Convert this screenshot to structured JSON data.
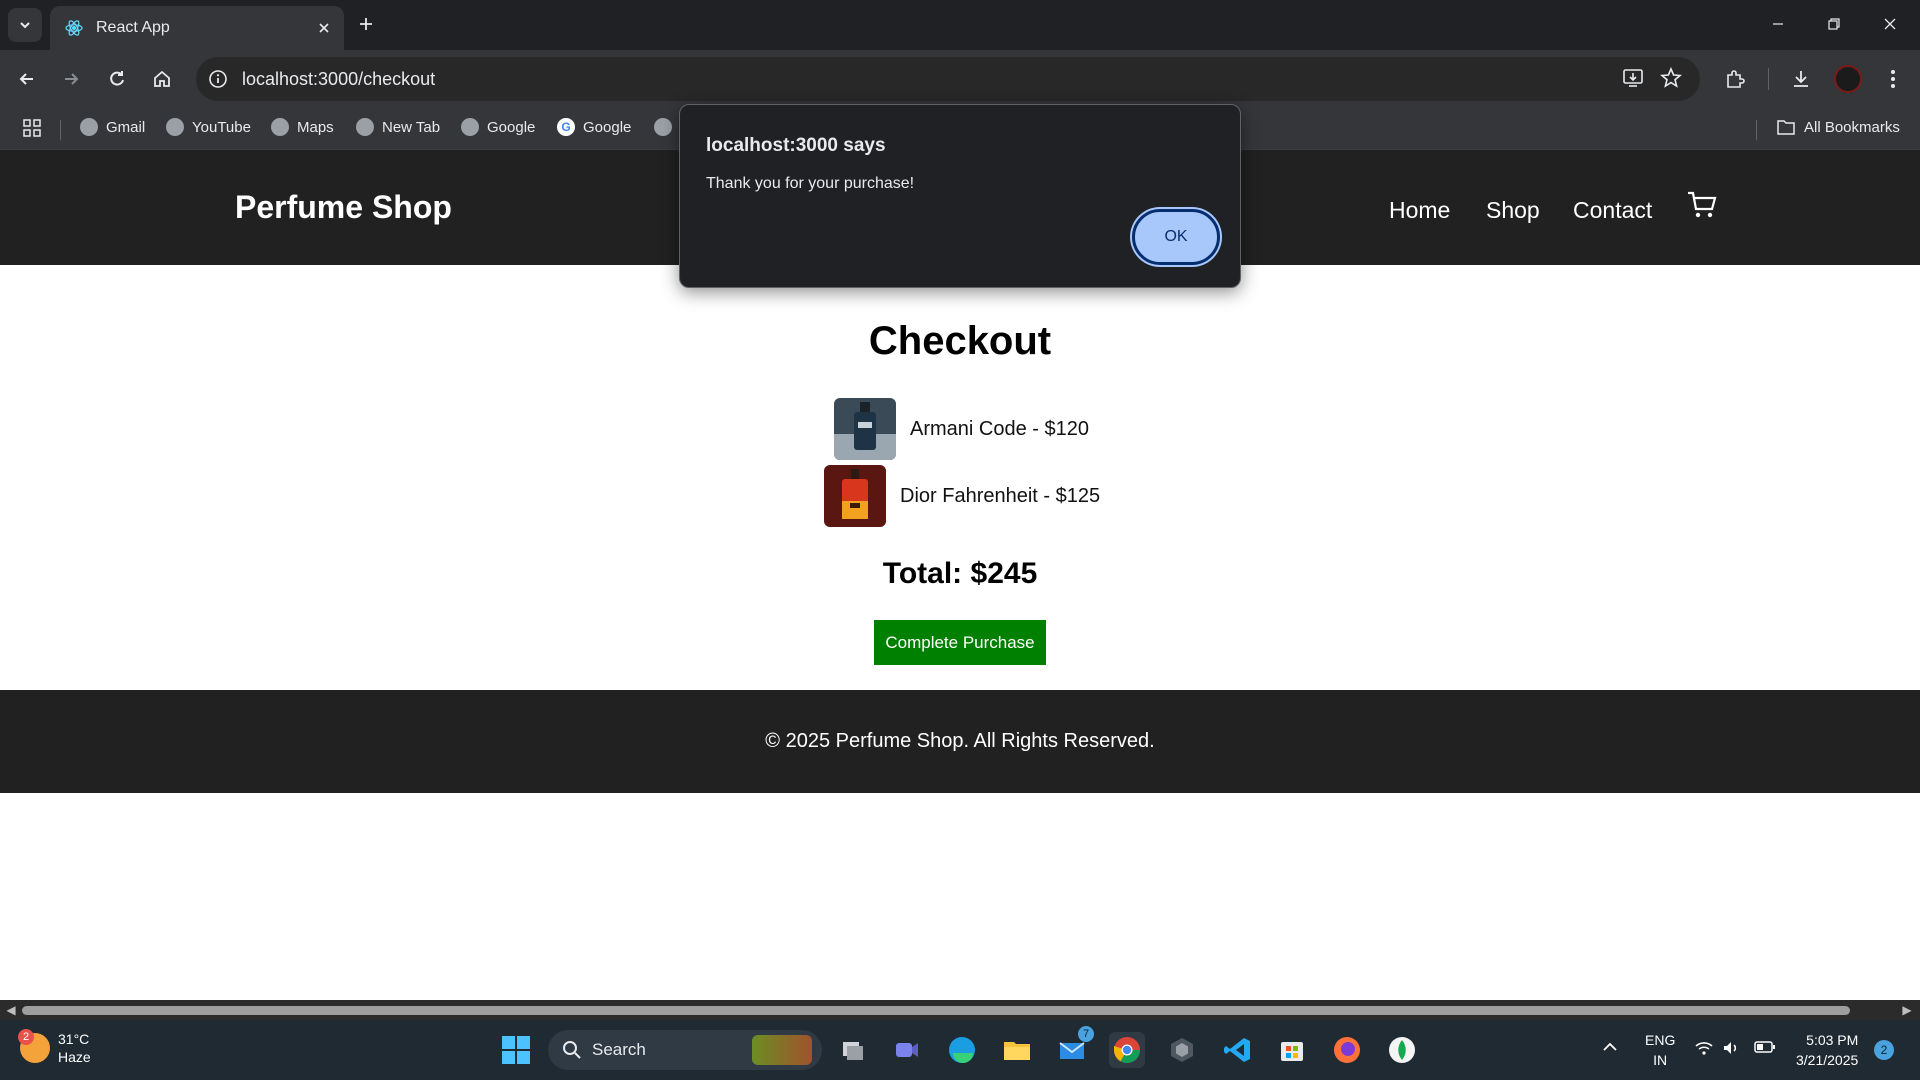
{
  "browser": {
    "tab_title": "React App",
    "url": "localhost:3000/checkout",
    "bookmarks": [
      "Gmail",
      "YouTube",
      "Maps",
      "New Tab",
      "Google",
      "Google"
    ],
    "all_bookmarks": "All Bookmarks"
  },
  "dialog": {
    "title": "localhost:3000 says",
    "message": "Thank you for your purchase!",
    "ok_label": "OK"
  },
  "site": {
    "brand": "Perfume Shop",
    "nav": [
      "Home",
      "Shop",
      "Contact"
    ],
    "checkout_title": "Checkout",
    "items": [
      {
        "label": "Armani Code - $120"
      },
      {
        "label": "Dior Fahrenheit - $125"
      }
    ],
    "total": "Total: $245",
    "purchase_button": "Complete Purchase",
    "footer": "© 2025 Perfume Shop. All Rights Reserved."
  },
  "taskbar": {
    "weather_badge": "2",
    "temperature": "31°C",
    "condition": "Haze",
    "search_placeholder": "Search",
    "mail_badge": "7",
    "lang_line1": "ENG",
    "lang_line2": "IN",
    "time": "5:03 PM",
    "date": "3/21/2025",
    "notifications": "2"
  },
  "colors": {
    "purchase_button": "#008000",
    "navbar": "#212121",
    "dialog_ok": "#a8c7fa"
  }
}
